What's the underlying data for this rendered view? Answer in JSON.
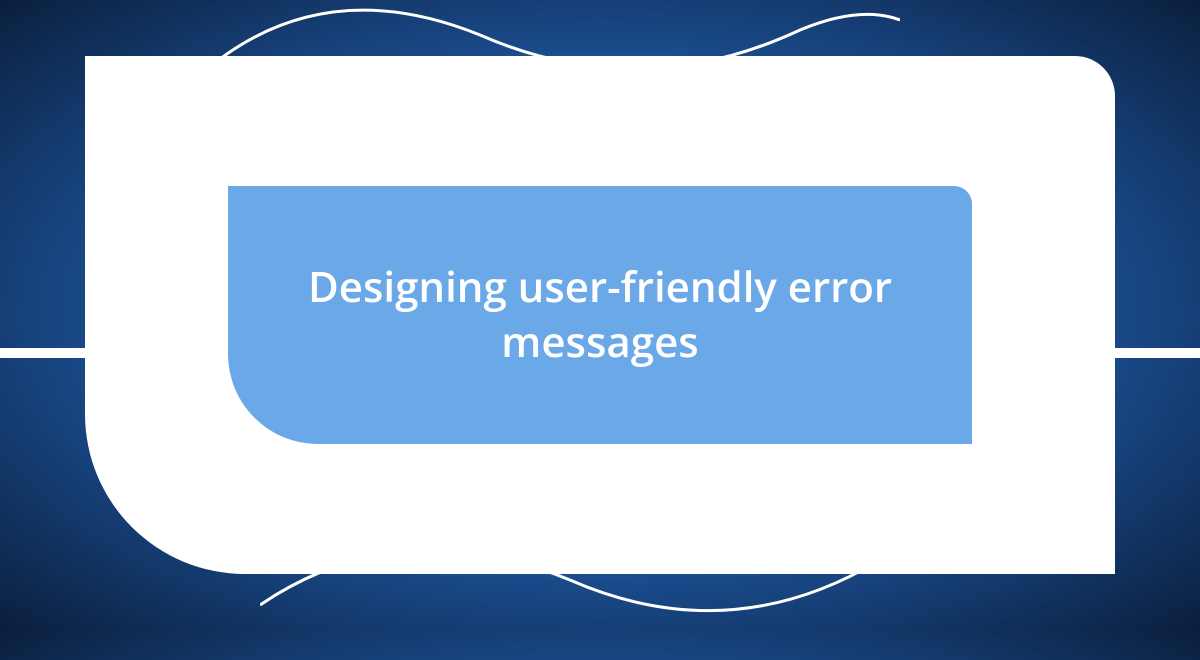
{
  "title": "Designing user-friendly error messages"
}
